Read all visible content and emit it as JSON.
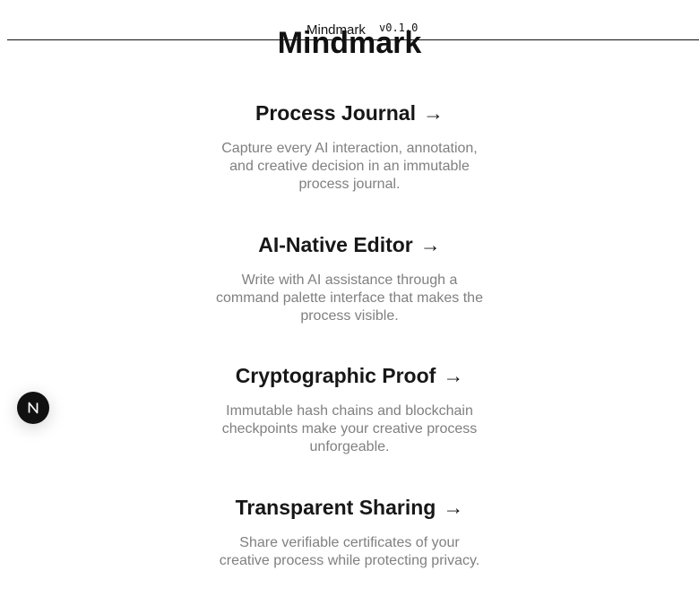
{
  "header": {
    "app_name": "Mindmark",
    "version": "v0.1.0"
  },
  "hero": {
    "title": "Mindmark"
  },
  "features": [
    {
      "title": "Process Journal",
      "arrow": "→",
      "description": "Capture every AI interaction, annotation, and creative decision in an immutable process journal."
    },
    {
      "title": "AI-Native Editor",
      "arrow": "→",
      "description": "Write with AI assistance through a command palette interface that makes the process visible."
    },
    {
      "title": "Cryptographic Proof",
      "arrow": "→",
      "description": "Immutable hash chains and blockchain checkpoints make your creative process unforgeable."
    },
    {
      "title": "Transparent Sharing",
      "arrow": "→",
      "description": "Share verifiable certificates of your creative process while protecting privacy."
    }
  ],
  "dev_badge": {
    "icon": "nextjs-logo-icon",
    "letter": "N"
  },
  "colors": {
    "text": "#171717",
    "muted": "#808080",
    "badge_bg": "#111111"
  }
}
